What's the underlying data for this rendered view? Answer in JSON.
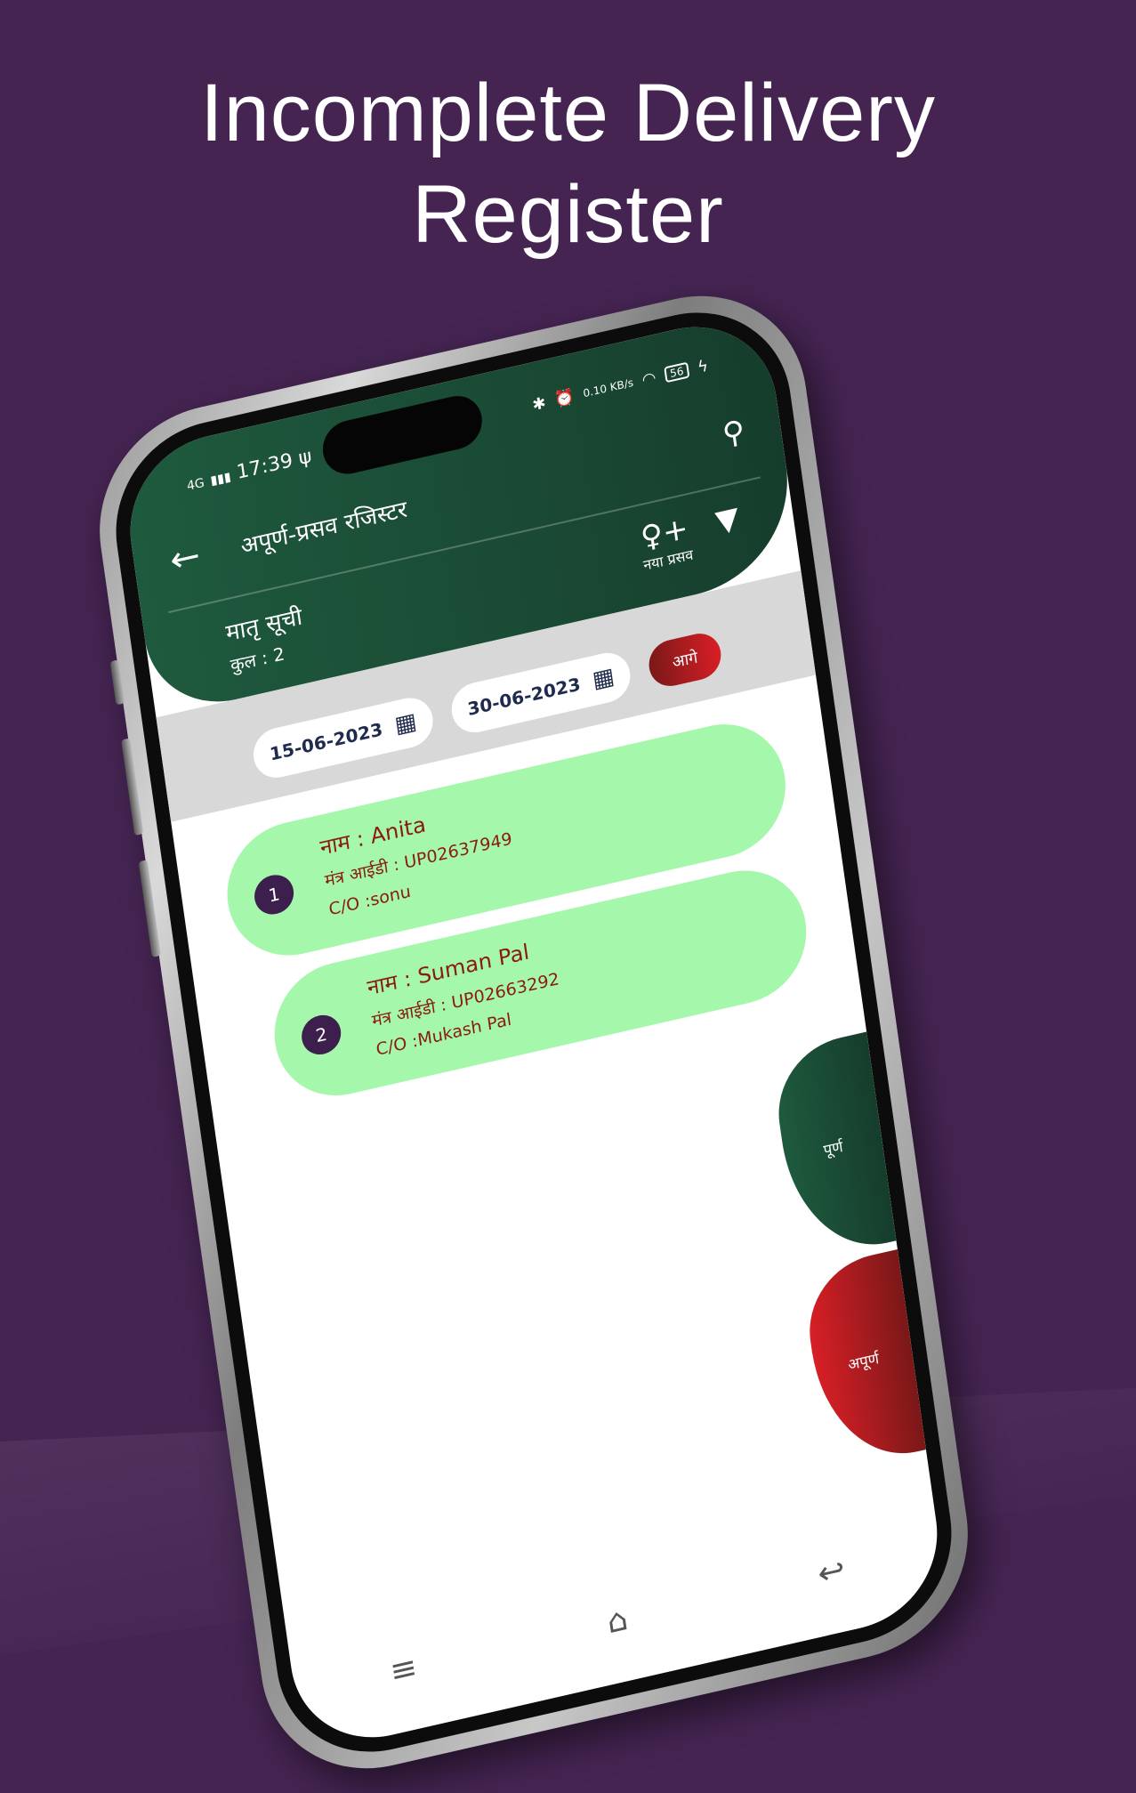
{
  "headline": {
    "line1": "Incomplete Delivery",
    "line2": "Register"
  },
  "status_bar": {
    "network": "4G",
    "time": "17:39",
    "speed": "0.10 KB/s",
    "battery": "56"
  },
  "header": {
    "title": "अपूर्ण-प्रसव रजिस्टर",
    "list_title": "मातृ सूची",
    "count_label": "कुल : 2",
    "new_delivery_label": "नया प्रसव"
  },
  "date_filter": {
    "from": "15-06-2023",
    "to": "30-06-2023",
    "next_label": "आगे"
  },
  "records": [
    {
      "index": "1",
      "name": "नाम : Anita",
      "mantra_id": "मंत्र आईडी : UP02637949",
      "co": "C/O :sonu"
    },
    {
      "index": "2",
      "name": "नाम : Suman Pal",
      "mantra_id": "मंत्र आईडी : UP02663292",
      "co": "C/O :Mukash Pal"
    }
  ],
  "side_tabs": {
    "complete": "पूर्ण",
    "incomplete": "अपूर्ण"
  },
  "icons": {
    "back": "arrow-left",
    "search": "magnifier",
    "new_delivery": "person-plus",
    "filter": "funnel",
    "calendar": "calendar",
    "nav_menu": "menu",
    "nav_home": "home",
    "nav_back": "return"
  },
  "colors": {
    "background": "#452452",
    "header_green": "#1e5a3e",
    "card_green": "#a5f8ab",
    "accent_red": "#d81f26",
    "text_red": "#8a1a12"
  }
}
